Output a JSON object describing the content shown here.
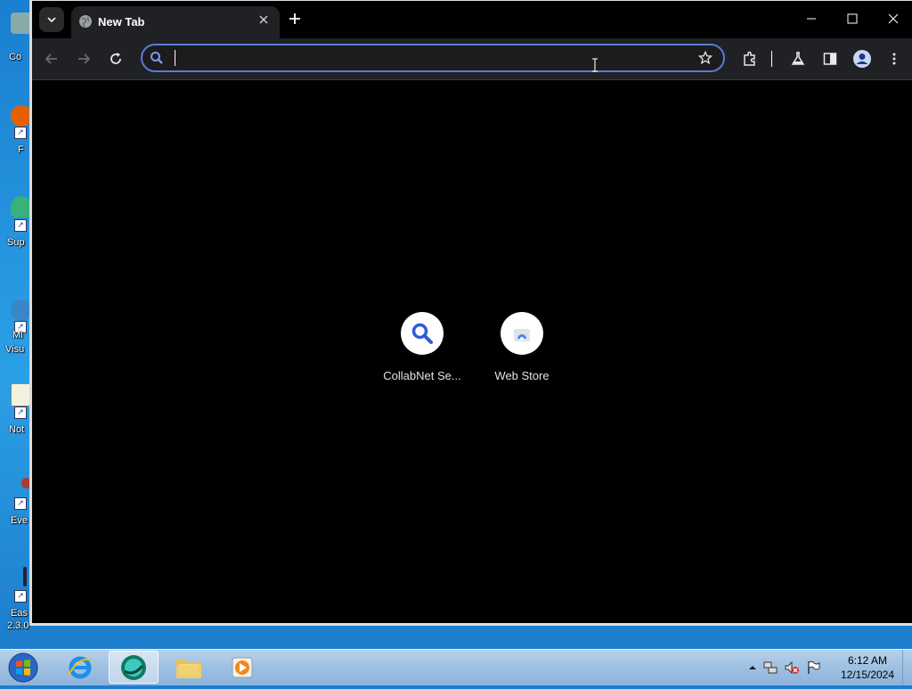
{
  "desktop": {
    "icons": [
      {
        "label": "Co"
      },
      {
        "label": "F"
      },
      {
        "label": "Sup"
      },
      {
        "label": "Mi"
      },
      {
        "label": "Visu"
      },
      {
        "label": "Not"
      },
      {
        "label": "Eve"
      },
      {
        "label": "Eas"
      },
      {
        "label": "2.3.0"
      }
    ]
  },
  "browser": {
    "tab": {
      "title": "New Tab"
    },
    "omnibox": {
      "value": "",
      "placeholder": ""
    },
    "accent": "#5a7bd6"
  },
  "ntp": {
    "shortcuts": [
      {
        "name": "CollabNet Se..."
      },
      {
        "name": "Web Store"
      }
    ]
  },
  "taskbar": {
    "clock": {
      "time": "6:12 AM",
      "date": "12/15/2024"
    }
  }
}
